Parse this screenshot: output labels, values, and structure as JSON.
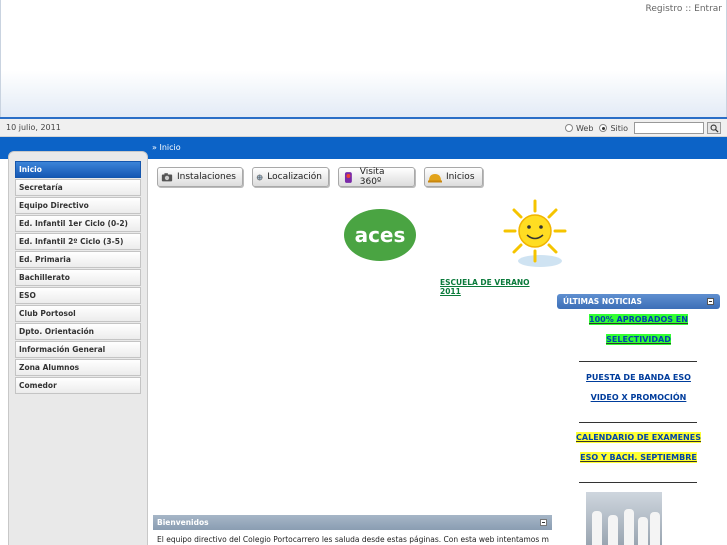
{
  "header": {
    "register_label": "Registro",
    "separator": "::",
    "login_label": "Entrar"
  },
  "bar": {
    "date": "10 julio, 2011",
    "search_option_web": "Web",
    "search_option_site": "Sitio",
    "selected_option": "Sitio",
    "search_value": ""
  },
  "breadcrumb": {
    "prefix": "»",
    "current": "Inicio"
  },
  "sidebar": {
    "items": [
      {
        "label": "Inicio",
        "active": true
      },
      {
        "label": "Secretaría"
      },
      {
        "label": "Equipo Directivo"
      },
      {
        "label": "Ed. Infantil 1er Ciclo (0-2)"
      },
      {
        "label": "Ed. Infantil 2º Ciclo (3-5)"
      },
      {
        "label": "Ed. Primaria"
      },
      {
        "label": "Bachillerato"
      },
      {
        "label": "ESO"
      },
      {
        "label": "Club Portosol"
      },
      {
        "label": "Dpto. Orientación"
      },
      {
        "label": "Información General"
      },
      {
        "label": "Zona Alumnos"
      },
      {
        "label": "Comedor"
      }
    ]
  },
  "toolbar": {
    "buttons": [
      {
        "label": "Instalaciones",
        "icon": "camera-icon"
      },
      {
        "label": "Localización",
        "icon": "globe-icon"
      },
      {
        "label": "Visita 360º",
        "icon": "viewer-icon"
      },
      {
        "label": "Inicios",
        "icon": "helmet-icon"
      }
    ]
  },
  "content": {
    "logo_text": "aces",
    "summer_link": "ESCUELA DE VERANO 2011",
    "welcome_title": "Bienvenidos",
    "welcome_text": "El equipo directivo del Colegio Portocarrero les saluda desde estas páginas. Con esta web intentamos mejorar los"
  },
  "news": {
    "title": "ÚLTIMAS NOTICIAS",
    "items": [
      {
        "line1": "100% APROBADOS EN",
        "line2": "SELECTIVIDAD"
      },
      {
        "line1": "PUESTA DE BANDA ESO"
      },
      {
        "line1": "VIDEO X PROMOCIÓN"
      },
      {
        "line1": "CALENDARIO DE EXAMENES",
        "line2": "ESO Y BACH. SEPTIEMBRE"
      }
    ]
  },
  "colors": {
    "accent_blue": "#0c63c7",
    "active_menu": "#1558b4",
    "highlight_green": "#33ff33",
    "highlight_yellow": "#ffff33"
  }
}
